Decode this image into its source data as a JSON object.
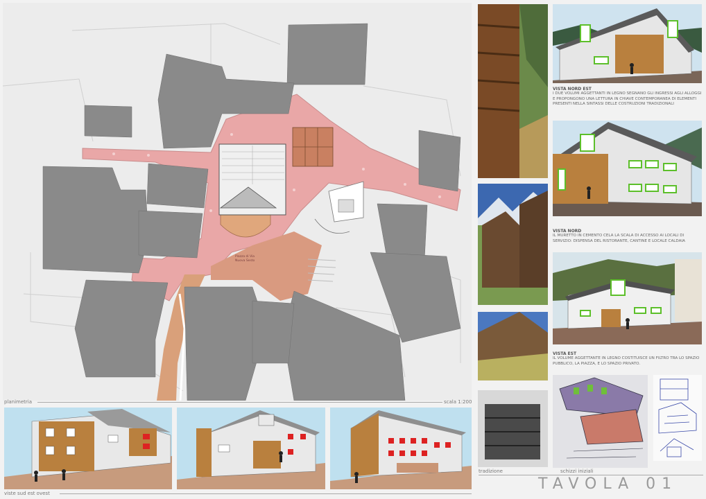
{
  "board": {
    "title": "TAVOLA 01"
  },
  "plan": {
    "label": "planimetria",
    "scale": "scala 1:200",
    "square_label_line1": "Piazza di Via",
    "square_label_line2": "Nuova Sesto"
  },
  "views": {
    "label": "viste sud est ovest"
  },
  "right": {
    "tradition_label": "tradizione",
    "sketch_label": "schizzi iniziali",
    "captions": [
      {
        "title": "VISTA NORD EST",
        "text": "I due volumi aggettanti in legno segnano gli ingressi agli alloggi e propongono una lettura in chiave contemporanea di elementi presenti nella sintassi delle costruzioni tradizionali"
      },
      {
        "title": "VISTA NORD",
        "text": "Il muretto in cemento cela la scala di accesso ai locali di servizio: dispensa del ristorante, cantine e locale caldaia"
      },
      {
        "title": "VISTA EST",
        "text": "Il volume aggettante in legno costituisce un filtro tra lo spazio pubblico, la piazza, e lo spazio privato."
      }
    ]
  },
  "colors": {
    "square": "#e9a7a7",
    "buildings": "#8a8a8a",
    "path": "#d9a07a",
    "wood": "#b9803e",
    "window_frame": "#5cbf2a",
    "sky": "#bfe0ef"
  }
}
